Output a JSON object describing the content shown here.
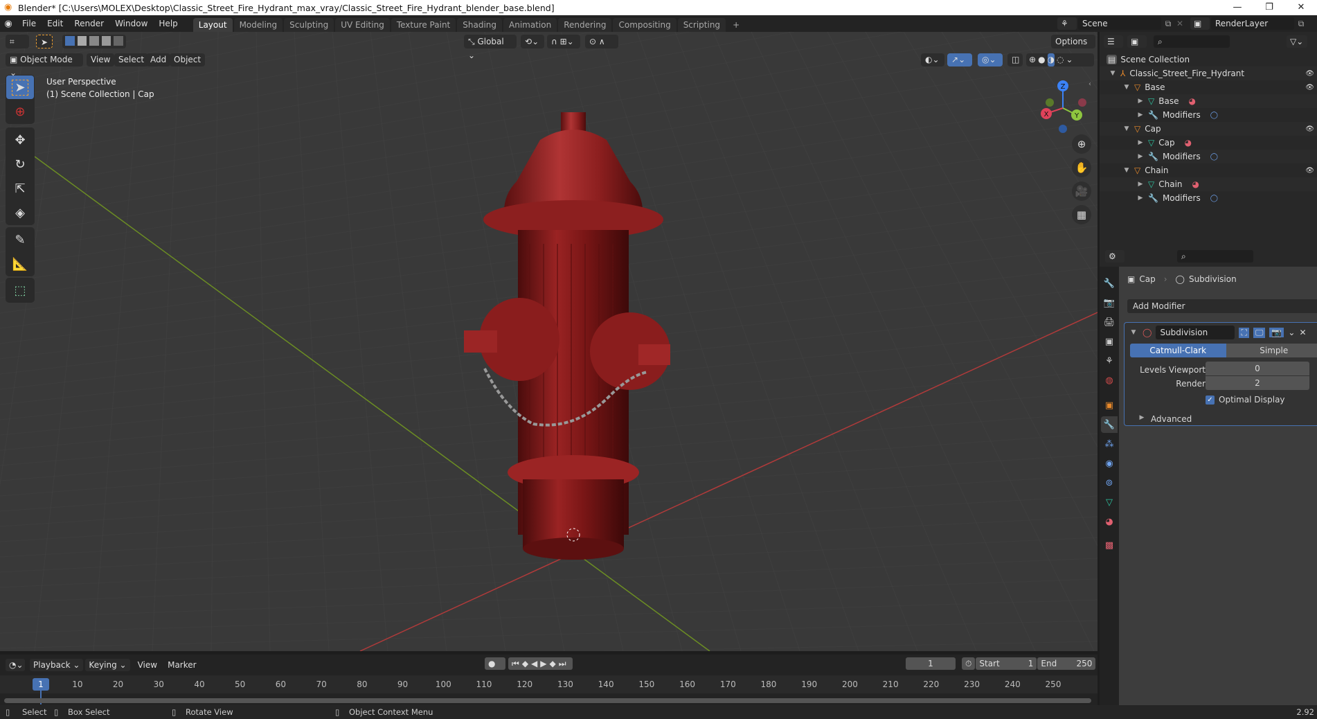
{
  "window": {
    "title": "Blender* [C:\\Users\\MOLEX\\Desktop\\Classic_Street_Fire_Hydrant_max_vray/Classic_Street_Fire_Hydrant_blender_base.blend]",
    "controls": {
      "minimize": "—",
      "maximize": "❐",
      "close": "✕"
    }
  },
  "menubar": {
    "items": [
      "File",
      "Edit",
      "Render",
      "Window",
      "Help"
    ],
    "workspaces": [
      "Layout",
      "Modeling",
      "Sculpting",
      "UV Editing",
      "Texture Paint",
      "Shading",
      "Animation",
      "Rendering",
      "Compositing",
      "Scripting"
    ],
    "active_workspace": "Layout",
    "add_tab": "+",
    "scene": "Scene",
    "render_layer": "RenderLayer"
  },
  "viewport_header": {
    "transform_orientation": "Global",
    "options": "Options",
    "mode": "Object Mode",
    "menus": [
      "View",
      "Select",
      "Add",
      "Object"
    ]
  },
  "viewport": {
    "perspective_label": "User Perspective",
    "collection_label": "(1) Scene Collection | Cap",
    "gizmo_axes": {
      "x": "X",
      "y": "Y",
      "z": "Z"
    },
    "colors": {
      "background": "#393939",
      "x_axis": "#b03a3a",
      "y_axis": "#6c8e23",
      "hydrant": "#8c1c1c",
      "chain": "#8a8a8a"
    }
  },
  "tools": [
    "select-box",
    "cursor",
    "move",
    "rotate",
    "scale",
    "transform",
    "annotate",
    "measure",
    "add-cube"
  ],
  "outliner": {
    "root": "Scene Collection",
    "items": [
      {
        "label": "Classic_Street_Fire_Hydrant",
        "type": "empty",
        "depth": 0
      },
      {
        "label": "Base",
        "type": "object",
        "depth": 1
      },
      {
        "label": "Base",
        "type": "mesh",
        "depth": 2
      },
      {
        "label": "Modifiers",
        "type": "modifiers",
        "depth": 2
      },
      {
        "label": "Cap",
        "type": "object",
        "depth": 1
      },
      {
        "label": "Cap",
        "type": "mesh",
        "depth": 2
      },
      {
        "label": "Modifiers",
        "type": "modifiers",
        "depth": 2
      },
      {
        "label": "Chain",
        "type": "object",
        "depth": 1
      },
      {
        "label": "Chain",
        "type": "mesh",
        "depth": 2
      },
      {
        "label": "Modifiers",
        "type": "modifiers",
        "depth": 2
      }
    ]
  },
  "properties": {
    "breadcrumb_object": "Cap",
    "breadcrumb_modifier": "Subdivision",
    "add_modifier": "Add Modifier",
    "modifier": {
      "name": "Subdivision",
      "type_options": [
        "Catmull-Clark",
        "Simple"
      ],
      "selected_type": "Catmull-Clark",
      "levels_viewport_label": "Levels Viewport",
      "levels_viewport": "0",
      "render_label": "Render",
      "render": "2",
      "optimal_display_label": "Optimal Display",
      "optimal_display": true,
      "advanced_label": "Advanced"
    }
  },
  "timeline": {
    "menus": [
      "Playback",
      "Keying",
      "View",
      "Marker"
    ],
    "current_frame": "1",
    "start_label": "Start",
    "start": "1",
    "end_label": "End",
    "end": "250",
    "ticks": [
      "10",
      "20",
      "30",
      "40",
      "50",
      "60",
      "70",
      "80",
      "90",
      "100",
      "110",
      "120",
      "130",
      "140",
      "150",
      "160",
      "170",
      "180",
      "190",
      "200",
      "210",
      "220",
      "230",
      "240",
      "250"
    ]
  },
  "statusbar": {
    "select": "Select",
    "box_select": "Box Select",
    "rotate_view": "Rotate View",
    "context_menu": "Object Context Menu",
    "version": "2.92"
  }
}
